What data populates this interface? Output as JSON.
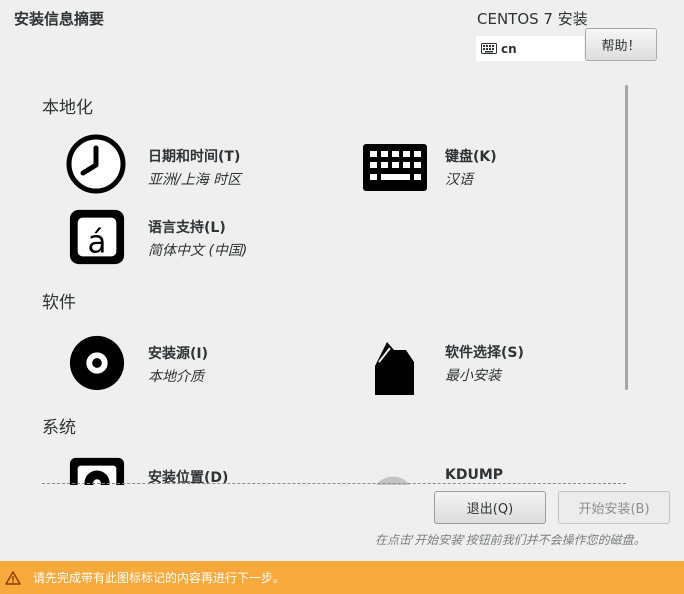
{
  "header": {
    "title": "安装信息摘要",
    "product": "CENTOS 7 安装",
    "keyboard_layout": "cn",
    "help_label": "帮助！"
  },
  "sections": {
    "localization": {
      "title": "本地化",
      "datetime": {
        "title": "日期和时间(T)",
        "status": "亚洲/上海 时区",
        "icon": "clock-icon"
      },
      "keyboard": {
        "title": "键盘(K)",
        "status": "汉语",
        "icon": "keyboard-icon"
      },
      "language": {
        "title": "语言支持(L)",
        "status": "简体中文 (中国)",
        "icon": "language-icon"
      }
    },
    "software": {
      "title": "软件",
      "source": {
        "title": "安装源(I)",
        "status": "本地介质",
        "icon": "disc-icon"
      },
      "selection": {
        "title": "软件选择(S)",
        "status": "最小安装",
        "icon": "package-icon"
      }
    },
    "system": {
      "title": "系统",
      "destination": {
        "title": "安装位置(D)",
        "icon": "harddisk-icon"
      },
      "kdump": {
        "title": "KDUMP",
        "icon": "kdump-icon"
      }
    }
  },
  "footer": {
    "quit_label": "退出(Q)",
    "begin_label": "开始安装(B)",
    "hint": "在点击'开始安装'按钮前我们并不会操作您的磁盘。"
  },
  "warning": {
    "text": "请先完成带有此图标标记的内容再进行下一步。",
    "icon": "warning-icon"
  },
  "colors": {
    "background": "#efefef",
    "warning_bar": "#f7a93c",
    "icon_dark": "#000000"
  }
}
